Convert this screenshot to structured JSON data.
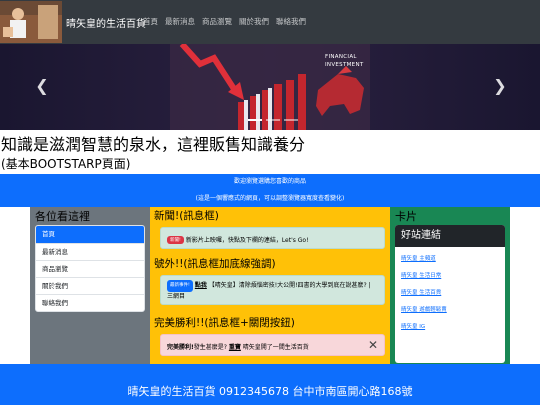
{
  "navbar": {
    "brand": "晴矢皇的生活百貨",
    "links": [
      "首頁",
      "最新消息",
      "商品瀏覽",
      "關於我們",
      "聯絡我們"
    ]
  },
  "carousel": {
    "image_text": [
      "FINANCIAL",
      "INVESTMENT"
    ],
    "prev_icon": "chevron-left-icon",
    "next_icon": "chevron-right-icon",
    "indicator_count": 3,
    "active_index": 0
  },
  "hero": {
    "title": "知識是滋潤智慧的泉水，這裡販售知識養分",
    "subtitle": "(基本BOOTSTARP頁面)"
  },
  "banner": {
    "line1": "歡迎瀏覽選購您喜歡的商品",
    "line2": "(這是一個響應式的網頁，可以調整瀏覽器寬度查看變化)"
  },
  "left_column": {
    "heading": "各位看這裡",
    "items": [
      "首頁",
      "最新消息",
      "商品瀏覽",
      "關於我們",
      "聯絡我們"
    ],
    "active_index": 0
  },
  "middle_column": {
    "news_heading": "新聞!(訊息框)",
    "news_badge": "新聞!",
    "news_text": "新影片上映囉，快點及下欄的連結，Let's Go!",
    "extra_heading": "號外!!(訊息框加底線強調)",
    "extra_badge": "最新事件!",
    "extra_link": "點我",
    "extra_text": "【晴矢皇】清除煩惱密技!大公開!四書的大學到底在說甚麼? | 三網目",
    "win_heading": "完美勝利!!(訊息框+關閉按鈕)",
    "win_bold": "完美勝利!",
    "win_text1": "發生甚麼是?",
    "win_link": "重寶",
    "win_text2": "晴矢皇開了一間生活百貨"
  },
  "right_column": {
    "heading": "卡片",
    "card_title": "好站連結",
    "links": [
      "晴矢皇 主頻道",
      "晴矢皇 生活日常",
      "晴矢皇 生活百貨",
      "晴矢皇 遊戲輕鬆賣",
      "晴矢皇 IG"
    ]
  },
  "footer": {
    "text": "晴矢皇的生活百貨 0912345678 台中市南區開心路168號"
  },
  "colors": {
    "navbar": "#343a40",
    "primary": "#0d6efd",
    "secondary": "#6c757d",
    "warning": "#ffc107",
    "success": "#198754"
  }
}
